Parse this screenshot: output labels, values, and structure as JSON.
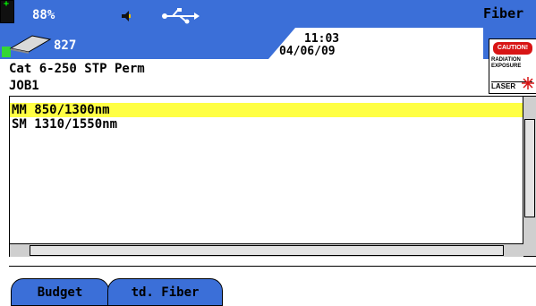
{
  "status": {
    "battery_percent": "88%",
    "memory_value": "827",
    "mode_label": "Fiber",
    "time": "11:03",
    "date": "04/06/09",
    "icons": {
      "battery": "battery-icon",
      "memory": "memory-card-icon",
      "speaker": "speaker-icon",
      "usb": "usb-icon",
      "warning": "laser-caution-icon"
    },
    "colors": {
      "header_blue": "#3b6fd8",
      "selection_yellow": "#ffff44"
    }
  },
  "caution_label": {
    "title": "CAUTION!",
    "line1": "RADIATION",
    "line2": "EXPOSURE",
    "line3": "LASER"
  },
  "test": {
    "cable_type": "Cat 6-250 STP Perm",
    "job": "JOB1"
  },
  "list": {
    "items": [
      {
        "label": "MM 850/1300nm",
        "selected": true
      },
      {
        "label": "SM 1310/1550nm",
        "selected": false
      }
    ]
  },
  "softkeys": {
    "budget": "Budget",
    "std_fiber": "td. Fiber"
  }
}
